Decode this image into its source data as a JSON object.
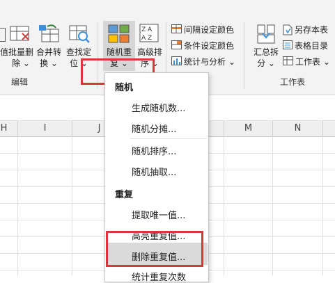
{
  "ribbon": {
    "partial_left_label": "值",
    "buttons": [
      {
        "line1": "批量删",
        "line2": "除 ⌄"
      },
      {
        "line1": "合并转",
        "line2": "换 ⌄"
      },
      {
        "line1": "查找定",
        "line2": "位 ⌄"
      },
      {
        "line1": "随机重",
        "line2": "复 ⌄"
      },
      {
        "line1": "高级排",
        "line2": "序 ⌄"
      }
    ],
    "small_buttons": [
      "间隔设定颜色",
      "条件设定颜色",
      "统计与分析 ⌄"
    ],
    "right_big": {
      "line1": "汇总拆",
      "line2": "分 ⌄"
    },
    "right_small": [
      "另存本表",
      "表格目录",
      "工作表 ⌄"
    ],
    "groups": {
      "edit": "编辑",
      "sheet": "工作表"
    }
  },
  "columns": [
    "H",
    "I",
    "J",
    "M",
    "N"
  ],
  "dropdown": {
    "sections": [
      {
        "header": "随机",
        "items": [
          "生成随机数...",
          "随机分摊...",
          "随机排序...",
          "随机抽取..."
        ]
      },
      {
        "header": "重复",
        "items": [
          "提取唯一值...",
          "高亮重复值...",
          "删除重复值...",
          "统计重复次数"
        ]
      }
    ]
  },
  "colors": {
    "highlight_red": "#d9373a",
    "ribbon_bg": "#f3f3f3",
    "active_button": "#d6d6d6"
  }
}
